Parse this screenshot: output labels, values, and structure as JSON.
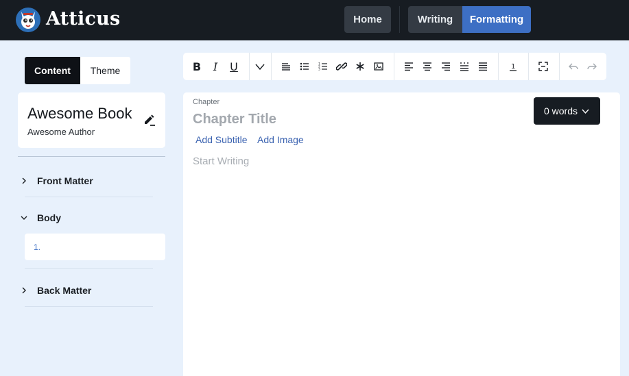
{
  "app": {
    "name": "Atticus"
  },
  "nav": {
    "home": "Home",
    "writing": "Writing",
    "formatting": "Formatting"
  },
  "sidebar_tabs": {
    "content": "Content",
    "theme": "Theme"
  },
  "book": {
    "title": "Awesome Book",
    "author": "Awesome Author"
  },
  "sections": [
    {
      "label": "Front Matter",
      "expanded": false
    },
    {
      "label": "Body",
      "expanded": true,
      "items": [
        {
          "label": "1."
        }
      ]
    },
    {
      "label": "Back Matter",
      "expanded": false
    }
  ],
  "toolbar": {
    "bold": "B",
    "italic": "I",
    "underline": "U",
    "icons": [
      "bold-icon",
      "italic-icon",
      "underline-icon",
      "more-chevron-icon",
      "paragraph-icon",
      "bullet-list-icon",
      "numbered-list-icon",
      "link-icon",
      "asterisk-icon",
      "image-icon",
      "align-left-icon",
      "align-center-icon",
      "align-right-icon",
      "align-distribute-icon",
      "align-justify-icon",
      "footnote-icon",
      "fullscreen-icon",
      "undo-icon",
      "redo-icon"
    ]
  },
  "editor": {
    "chapter_label": "Chapter",
    "chapter_title_placeholder": "Chapter Title",
    "add_subtitle": "Add Subtitle",
    "add_image": "Add Image",
    "body_placeholder": "Start Writing",
    "word_count": "0 words"
  },
  "colors": {
    "topbar": "#171c22",
    "accent": "#3d6fc4",
    "background": "#e8f1fc"
  }
}
